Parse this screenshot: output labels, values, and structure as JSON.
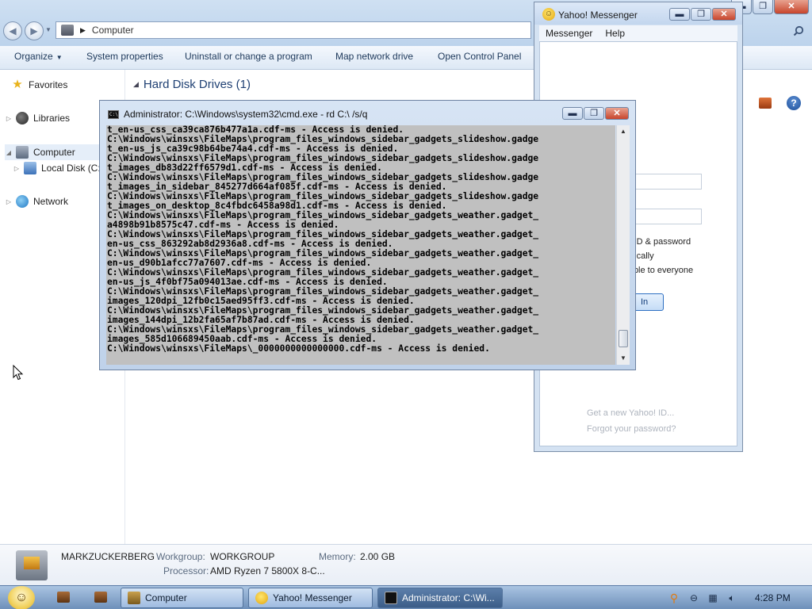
{
  "explorer": {
    "address": {
      "location": "Computer"
    },
    "toolbar": {
      "organize": "Organize",
      "system_properties": "System properties",
      "uninstall": "Uninstall or change a program",
      "map_drive": "Map network drive",
      "control_panel": "Open Control Panel"
    },
    "nav": {
      "favorites": "Favorites",
      "libraries": "Libraries",
      "computer": "Computer",
      "local_disk": "Local Disk (C:)",
      "network": "Network"
    },
    "main_header": "Hard Disk Drives (1)",
    "details": {
      "pc_name": "MARKZUCKERBERG",
      "workgroup_label": "Workgroup:",
      "workgroup": "WORKGROUP",
      "memory_label": "Memory:",
      "memory": "2.00 GB",
      "processor_label": "Processor:",
      "processor": "AMD Ryzen 7 5800X 8-C..."
    }
  },
  "yahoo": {
    "title": "Yahoo! Messenger",
    "menu": [
      "Messenger",
      "Help"
    ],
    "option_remember": "y ID & password",
    "option_auto": "atically",
    "option_visible": "sible to everyone",
    "signin_label": "In",
    "link_new_id": "Get a new Yahoo! ID...",
    "link_forgot": "Forgot your password?"
  },
  "cmd": {
    "title": "Administrator: C:\\Windows\\system32\\cmd.exe - rd  C:\\ /s/q",
    "lines": [
      "t_en-us_css_ca39ca876b477a1a.cdf-ms - Access is denied.",
      "C:\\Windows\\winsxs\\FileMaps\\program_files_windows_sidebar_gadgets_slideshow.gadge",
      "t_en-us_js_ca39c98b64be74a4.cdf-ms - Access is denied.",
      "C:\\Windows\\winsxs\\FileMaps\\program_files_windows_sidebar_gadgets_slideshow.gadge",
      "t_images_db83d22ff6579d1.cdf-ms - Access is denied.",
      "C:\\Windows\\winsxs\\FileMaps\\program_files_windows_sidebar_gadgets_slideshow.gadge",
      "t_images_in_sidebar_845277d664af085f.cdf-ms - Access is denied.",
      "C:\\Windows\\winsxs\\FileMaps\\program_files_windows_sidebar_gadgets_slideshow.gadge",
      "t_images_on_desktop_8c4fbdc6458a98d1.cdf-ms - Access is denied.",
      "C:\\Windows\\winsxs\\FileMaps\\program_files_windows_sidebar_gadgets_weather.gadget_",
      "a4898b91b8575c47.cdf-ms - Access is denied.",
      "C:\\Windows\\winsxs\\FileMaps\\program_files_windows_sidebar_gadgets_weather.gadget_",
      "en-us_css_863292ab8d2936a8.cdf-ms - Access is denied.",
      "C:\\Windows\\winsxs\\FileMaps\\program_files_windows_sidebar_gadgets_weather.gadget_",
      "en-us_d90b1afcc77a7607.cdf-ms - Access is denied.",
      "C:\\Windows\\winsxs\\FileMaps\\program_files_windows_sidebar_gadgets_weather.gadget_",
      "en-us_js_4f0bf75a094013ae.cdf-ms - Access is denied.",
      "C:\\Windows\\winsxs\\FileMaps\\program_files_windows_sidebar_gadgets_weather.gadget_",
      "images_120dpi_12fb0c15aed95ff3.cdf-ms - Access is denied.",
      "C:\\Windows\\winsxs\\FileMaps\\program_files_windows_sidebar_gadgets_weather.gadget_",
      "images_144dpi_12b2fa65af7b87ad.cdf-ms - Access is denied.",
      "C:\\Windows\\winsxs\\FileMaps\\program_files_windows_sidebar_gadgets_weather.gadget_",
      "images_585d106689450aab.cdf-ms - Access is denied.",
      "C:\\Windows\\winsxs\\FileMaps\\_0000000000000000.cdf-ms - Access is denied."
    ]
  },
  "taskbar": {
    "items": [
      "Computer",
      "Yahoo! Messenger",
      "Administrator: C:\\Wi..."
    ],
    "clock": "4:28 PM"
  },
  "icons": {
    "explorer": [
      "back-icon",
      "forward-icon",
      "computer-icon",
      "search-icon",
      "help-icon"
    ],
    "tray": [
      "search-icon",
      "network-icon",
      "volume-icon"
    ]
  },
  "colors": {
    "console_bg": "#c0c0c0",
    "taskbar": "#6e90ba",
    "title_blue": "#1e3f72"
  }
}
